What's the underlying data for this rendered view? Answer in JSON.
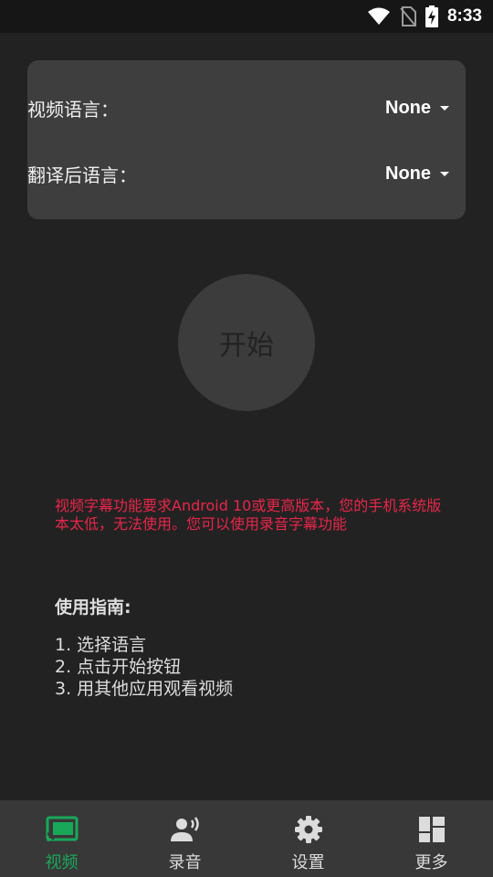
{
  "status_bar": {
    "time": "8:33"
  },
  "languages": {
    "video_label": "视频语言：",
    "video_value": "None",
    "translated_label": "翻译后语言：",
    "translated_value": "None"
  },
  "start_button": {
    "label": "开始"
  },
  "warning_text": "视频字幕功能要求Android 10或更高版本，您的手机系统版本太低，无法使用。您可以使用录音字幕功能",
  "guide": {
    "title": "使用指南:",
    "steps": [
      "1. 选择语言",
      "2. 点击开始按钮",
      "3. 用其他应用观看视频"
    ]
  },
  "bottom_nav": {
    "items": [
      {
        "label": "视频",
        "icon": "cast-icon",
        "active": true
      },
      {
        "label": "录音",
        "icon": "voice-icon",
        "active": false
      },
      {
        "label": "设置",
        "icon": "gear-icon",
        "active": false
      },
      {
        "label": "更多",
        "icon": "dashboard-icon",
        "active": false
      }
    ]
  },
  "colors": {
    "accent": "#19a85a",
    "warning": "#e8264a",
    "background": "#222222",
    "card": "#3e3e3e"
  }
}
